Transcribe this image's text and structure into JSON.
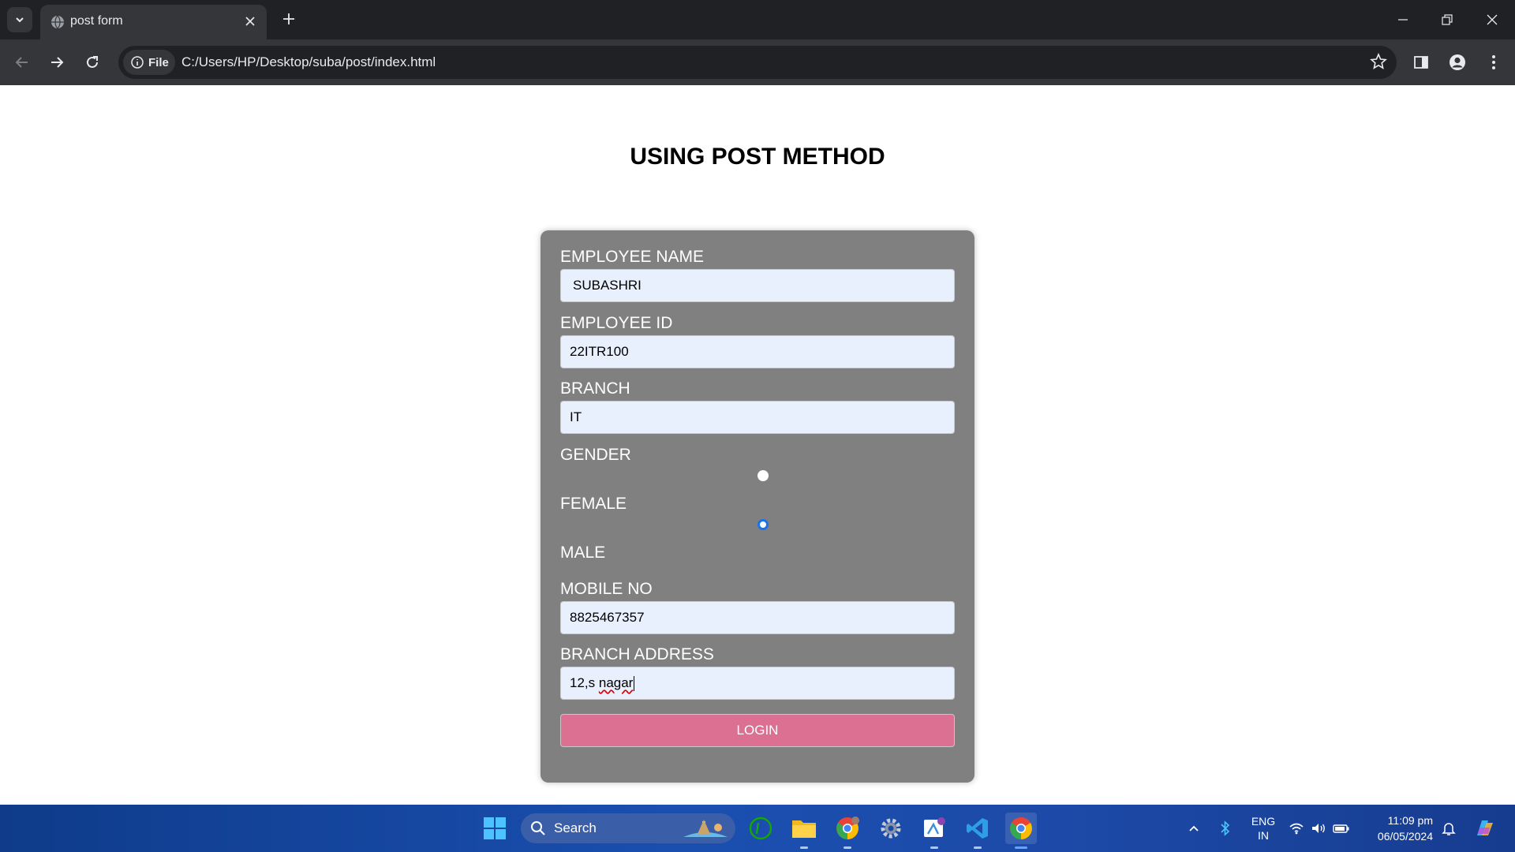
{
  "browser": {
    "tab_title": "post form",
    "url": "C:/Users/HP/Desktop/suba/post/index.html",
    "site_chip_label": "File"
  },
  "page": {
    "heading": "USING POST METHOD",
    "form": {
      "employee_name_label": "EMPLOYEE NAME",
      "employee_name_value": "SUBASHRI",
      "employee_id_label": "EMPLOYEE ID",
      "employee_id_value": "22ITR100",
      "branch_label": "BRANCH",
      "branch_value": "IT",
      "gender_label": "GENDER",
      "female_label": "FEMALE",
      "male_label": "MALE",
      "mobile_label": "MOBILE NO",
      "mobile_value": "8825467357",
      "address_label": "BRANCH ADDRESS",
      "address_prefix": "12,s ",
      "address_misspelled": "nagar",
      "login_label": "LOGIN"
    }
  },
  "taskbar": {
    "search_label": "Search",
    "language_top": "ENG",
    "language_bottom": "IN",
    "time": "11:09 pm",
    "date": "06/05/2024"
  },
  "colors": {
    "card_bg": "#808080",
    "field_bg": "#e8f0fe",
    "login_bg": "#db7093",
    "chrome_dark": "#202124",
    "chrome_toolbar": "#35363a"
  }
}
